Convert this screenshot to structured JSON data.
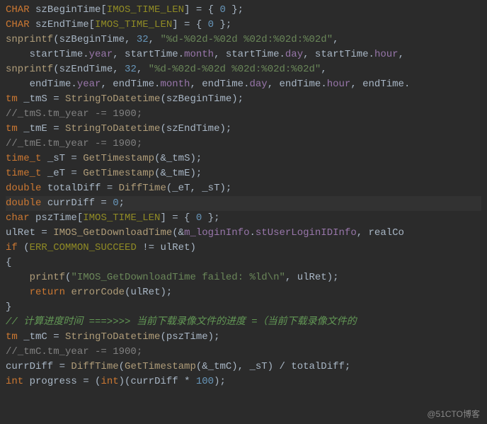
{
  "code": {
    "l1": {
      "p1": "CHAR",
      "p2": " szBeginTime[",
      "p3": "IMOS_TIME_LEN",
      "p4": "] = { ",
      "p5": "0",
      "p6": " };"
    },
    "l2": {
      "p1": "CHAR",
      "p2": " szEndTime[",
      "p3": "IMOS_TIME_LEN",
      "p4": "] = { ",
      "p5": "0",
      "p6": " };"
    },
    "l3": {
      "p1": "snprintf",
      "p2": "(szBeginTime, ",
      "p3": "32",
      "p4": ", ",
      "p5": "\"%d-%02d-%02d %02d:%02d:%02d\"",
      "p6": ","
    },
    "l4": {
      "p1": "    startTime.",
      "p2": "year",
      "p3": ", startTime.",
      "p4": "month",
      "p5": ", startTime.",
      "p6": "day",
      "p7": ", startTime.",
      "p8": "hour",
      "p9": ","
    },
    "l5": {
      "p1": "snprintf",
      "p2": "(szEndTime, ",
      "p3": "32",
      "p4": ", ",
      "p5": "\"%d-%02d-%02d %02d:%02d:%02d\"",
      "p6": ","
    },
    "l6": {
      "p1": "    endTime.",
      "p2": "year",
      "p3": ", endTime.",
      "p4": "month",
      "p5": ", endTime.",
      "p6": "day",
      "p7": ", endTime.",
      "p8": "hour",
      "p9": ", endTime."
    },
    "l7": {
      "p1": "tm",
      "p2": " _tmS = ",
      "p3": "StringToDatetime",
      "p4": "(szBeginTime);"
    },
    "l8": "//_tmS.tm_year -= 1900;",
    "l9": {
      "p1": "tm",
      "p2": " _tmE = ",
      "p3": "StringToDatetime",
      "p4": "(szEndTime);"
    },
    "l10": "//_tmE.tm_year -= 1900;",
    "l11": {
      "p1": "time_t",
      "p2": " _sT = ",
      "p3": "GetTimestamp",
      "p4": "(&_tmS);"
    },
    "l12": {
      "p1": "time_t",
      "p2": " _eT = ",
      "p3": "GetTimestamp",
      "p4": "(&_tmE);"
    },
    "l13": {
      "p1": "double",
      "p2": " totalDiff = ",
      "p3": "DiffTime",
      "p4": "(_eT, _sT);"
    },
    "l14": {
      "p1": "double",
      "p2": " currDiff = ",
      "p3": "0",
      "p4": ";"
    },
    "l15": {
      "p1": "char",
      "p2": " pszTime[",
      "p3": "IMOS_TIME_LEN",
      "p4": "] = { ",
      "p5": "0",
      "p6": " };"
    },
    "l16": {
      "p1": "ulRet = ",
      "p2": "IMOS_GetDownloadTime",
      "p3": "(&",
      "p4": "m_loginInfo",
      "p5": ".",
      "p6": "stUserLoginIDInfo",
      "p7": ", realCo"
    },
    "l17": {
      "p1": "if",
      "p2": " (",
      "p3": "ERR_COMMON_SUCCEED",
      "p4": " != ulRet)"
    },
    "l18": "{",
    "l19": {
      "p1": "    ",
      "p2": "printf",
      "p3": "(",
      "p4": "\"IMOS_GetDownloadTime failed: %ld\\n\"",
      "p5": ", ulRet);"
    },
    "l20": {
      "p1": "    ",
      "p2": "return",
      "p3": " ",
      "p4": "errorCode",
      "p5": "(ulRet);"
    },
    "l21": "}",
    "l22": "// 计算进度时间 ===>>>> 当前下载录像文件的进度 =（当前下载录像文件的",
    "l23": {
      "p1": "tm",
      "p2": " _tmC = ",
      "p3": "StringToDatetime",
      "p4": "(pszTime);"
    },
    "l24": "//_tmC.tm_year -= 1900;",
    "l25": {
      "p1": "currDiff = ",
      "p2": "DiffTime",
      "p3": "(",
      "p4": "GetTimestamp",
      "p5": "(&_tmC), _sT) / totalDiff;"
    },
    "l26": {
      "p1": "int",
      "p2": " progress = (",
      "p3": "int",
      "p4": ")(currDiff * ",
      "p5": "100",
      "p6": ");"
    }
  },
  "watermark": "@51CTO博客"
}
